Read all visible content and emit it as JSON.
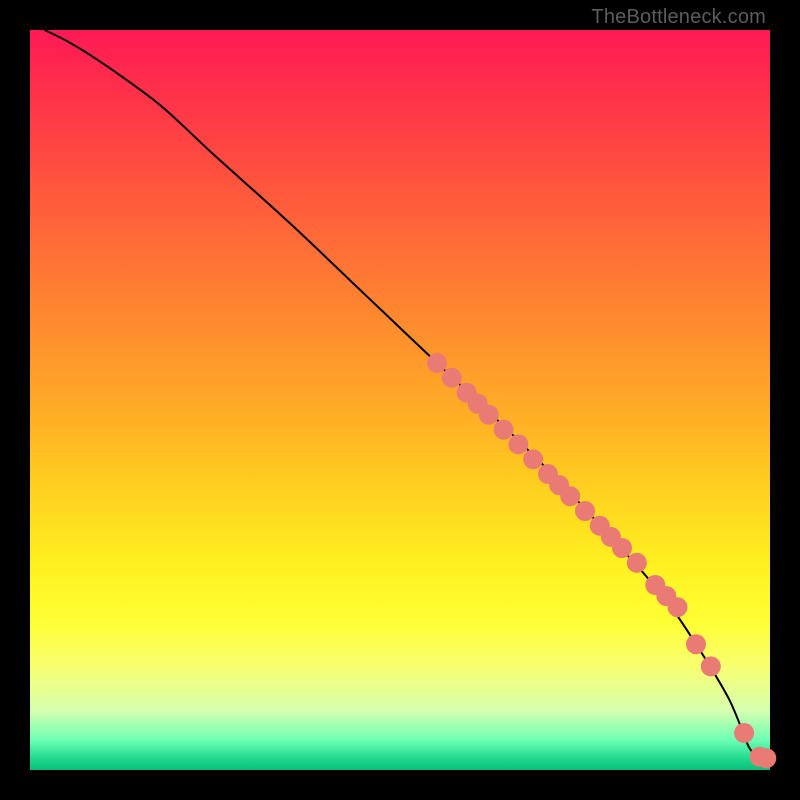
{
  "attribution": "TheBottleneck.com",
  "chart_data": {
    "type": "line",
    "title": "",
    "xlabel": "",
    "ylabel": "",
    "xlim": [
      0,
      100
    ],
    "ylim": [
      0,
      100
    ],
    "grid": false,
    "legend": false,
    "background_gradient": {
      "direction": "vertical",
      "stops": [
        {
          "t": 0.0,
          "color": "#ff1a55"
        },
        {
          "t": 0.4,
          "color": "#ff8c2e"
        },
        {
          "t": 0.72,
          "color": "#fff020"
        },
        {
          "t": 0.92,
          "color": "#d6ffb0"
        },
        {
          "t": 1.0,
          "color": "#0bbf7c"
        }
      ]
    },
    "series": [
      {
        "name": "curve",
        "kind": "line",
        "x": [
          2,
          5,
          8,
          12,
          18,
          25,
          35,
          45,
          55,
          65,
          72,
          78,
          83,
          87,
          90,
          92.5,
          94.5,
          96,
          97.2,
          98.4,
          99.3
        ],
        "y": [
          100,
          98.5,
          96.7,
          94,
          89.5,
          83,
          74,
          64.5,
          55,
          45.5,
          38.5,
          32,
          26.5,
          21.5,
          17,
          13,
          9.5,
          6,
          3,
          1.8,
          1.6
        ]
      },
      {
        "name": "dots",
        "kind": "scatter",
        "marker": {
          "color": "#e97b74",
          "size": 10
        },
        "x": [
          55,
          57,
          59,
          60.5,
          62,
          64,
          66,
          68,
          70,
          71.5,
          73,
          75,
          77,
          78.5,
          80,
          82,
          84.5,
          86,
          87.5,
          90,
          92,
          96.5,
          98.6,
          99.5
        ],
        "y": [
          55,
          53,
          51,
          49.5,
          48,
          46,
          44,
          42,
          40,
          38.5,
          37,
          35,
          33,
          31.5,
          30,
          28,
          25,
          23.5,
          22,
          17,
          14,
          5,
          1.8,
          1.6
        ]
      }
    ]
  }
}
